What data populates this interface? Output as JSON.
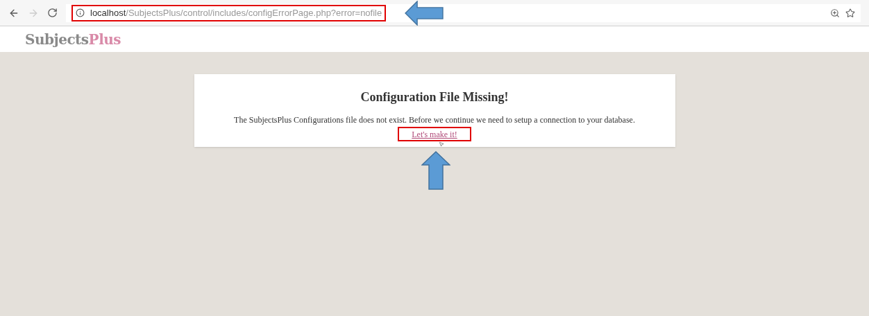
{
  "browser": {
    "back_enabled": true,
    "forward_enabled": false,
    "url_host": "localhost",
    "url_path": "/SubjectsPlus/control/includes/configErrorPage.php?error=nofile"
  },
  "logo": {
    "first": "Subjects",
    "second": "Plus"
  },
  "card": {
    "title": "Configuration File Missing!",
    "message": "The SubjectsPlus Configurations file does not exist. Before we continue we need to setup a connection to your database.",
    "link": "Let's make it!"
  }
}
